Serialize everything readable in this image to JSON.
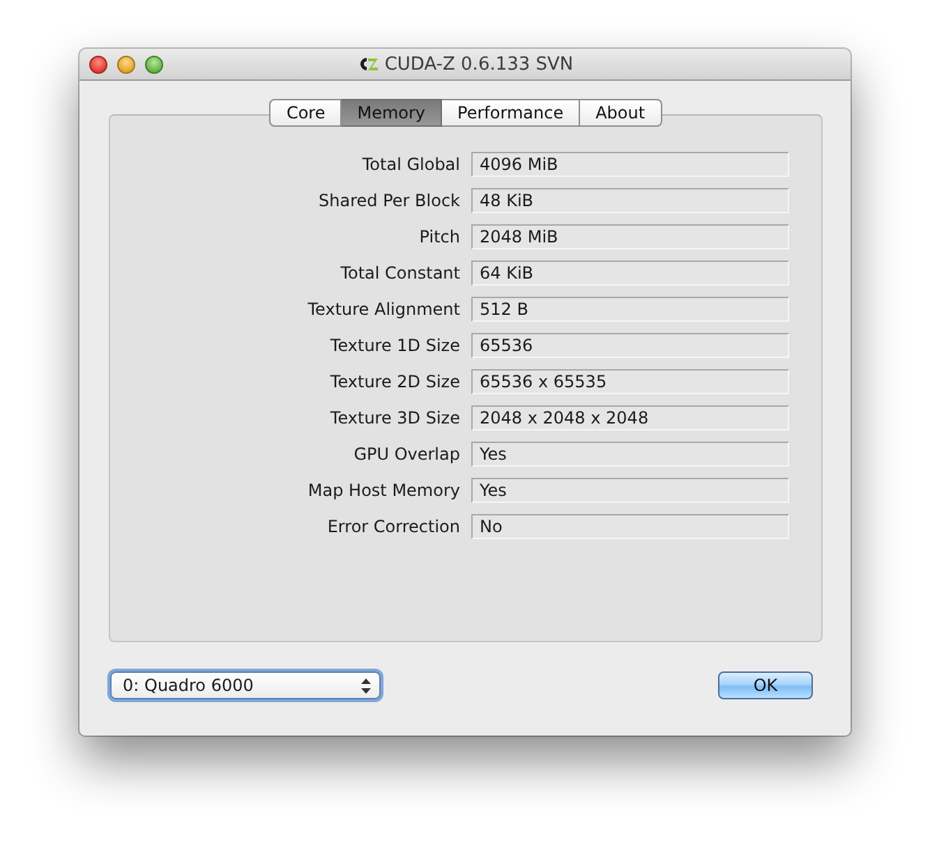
{
  "window": {
    "title": "CUDA-Z 0.6.133 SVN"
  },
  "tabs": [
    {
      "label": "Core",
      "selected": false
    },
    {
      "label": "Memory",
      "selected": true
    },
    {
      "label": "Performance",
      "selected": false
    },
    {
      "label": "About",
      "selected": false
    }
  ],
  "memory_info": [
    {
      "label": "Total Global",
      "value": "4096 MiB"
    },
    {
      "label": "Shared Per Block",
      "value": "48 KiB"
    },
    {
      "label": "Pitch",
      "value": "2048 MiB"
    },
    {
      "label": "Total Constant",
      "value": "64 KiB"
    },
    {
      "label": "Texture Alignment",
      "value": "512 B"
    },
    {
      "label": "Texture 1D Size",
      "value": "65536"
    },
    {
      "label": "Texture 2D Size",
      "value": "65536 x 65535"
    },
    {
      "label": "Texture 3D Size",
      "value": "2048 x 2048 x 2048"
    },
    {
      "label": "GPU Overlap",
      "value": "Yes"
    },
    {
      "label": "Map Host Memory",
      "value": "Yes"
    },
    {
      "label": "Error Correction",
      "value": "No"
    }
  ],
  "device_select": {
    "value": "0: Quadro 6000",
    "focused": true
  },
  "buttons": [
    {
      "label": "OK",
      "default": true
    }
  ]
}
